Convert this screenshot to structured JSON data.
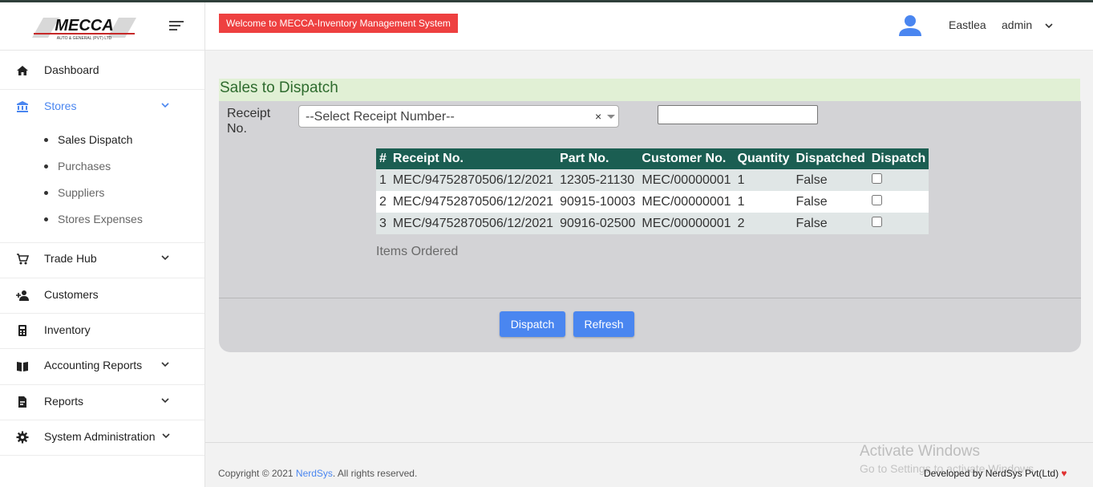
{
  "brand": {
    "logo_text": "MECCA",
    "logo_subtext": "AUTO & GENERAL (PVT) LTD"
  },
  "header": {
    "welcome": "Welcome to MECCA-Inventory Management System",
    "branch": "Eastlea",
    "user": "admin"
  },
  "sidebar": {
    "items": [
      {
        "label": "Dashboard",
        "icon": "home-icon"
      },
      {
        "label": "Stores",
        "icon": "bank-icon",
        "active": true,
        "color": "#4a86f0"
      },
      {
        "label": "Trade Hub",
        "icon": "cart-icon"
      },
      {
        "label": "Customers",
        "icon": "add-user-icon"
      },
      {
        "label": "Inventory",
        "icon": "calculator-icon"
      },
      {
        "label": "Accounting Reports",
        "icon": "book-icon"
      },
      {
        "label": "Reports",
        "icon": "document-icon"
      },
      {
        "label": "System Administration",
        "icon": "gear-icon"
      }
    ],
    "stores_sub": [
      "Sales Dispatch",
      "Purchases",
      "Suppliers",
      "Stores Expenses"
    ]
  },
  "main": {
    "title": "Sales to Dispatch",
    "receipt_label": "Receipt No.",
    "select_placeholder": "--Select Receipt Number--",
    "select_clear": "×",
    "table": {
      "headers": [
        "#",
        "Receipt No.",
        "Part No.",
        "Customer No.",
        "Quantity",
        "Dispatched",
        "Dispatch"
      ],
      "rows": [
        {
          "num": "1",
          "receipt": "MEC/94752870506/12/2021",
          "part": "12305-21130",
          "customer": "MEC/00000001",
          "qty": "1",
          "dispatched": "False"
        },
        {
          "num": "2",
          "receipt": "MEC/94752870506/12/2021",
          "part": "90915-10003",
          "customer": "MEC/00000001",
          "qty": "1",
          "dispatched": "False"
        },
        {
          "num": "3",
          "receipt": "MEC/94752870506/12/2021",
          "part": "90916-02500",
          "customer": "MEC/00000001",
          "qty": "2",
          "dispatched": "False"
        }
      ]
    },
    "caption": "Items Ordered",
    "buttons": {
      "dispatch": "Dispatch",
      "refresh": "Refresh"
    }
  },
  "footer": {
    "copyright_prefix": "Copyright © 2021 ",
    "company_link": "NerdSys",
    "copyright_suffix": ". All rights reserved.",
    "developed": "Developed by NerdSys Pvt(Ltd) ",
    "heart": "♥"
  },
  "watermark": {
    "line1": "Activate Windows",
    "line2": "Go to Settings to activate Windows."
  },
  "colors": {
    "accent": "#4a86f0",
    "table_header": "#1b5e52",
    "welcome_bg": "#ee4040",
    "title_bg": "#e1f0d5"
  }
}
